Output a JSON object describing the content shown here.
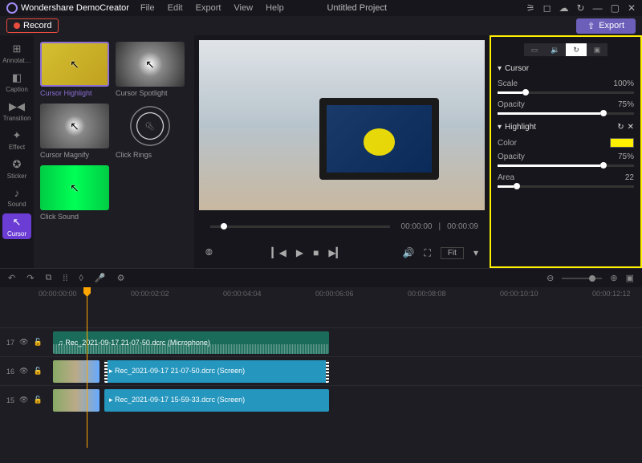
{
  "app": {
    "name": "Wondershare DemoCreator",
    "project": "Untitled Project"
  },
  "menu": [
    "File",
    "Edit",
    "Export",
    "View",
    "Help"
  ],
  "toolbar": {
    "record": "Record",
    "export": "Export"
  },
  "sidebar": [
    {
      "icon": "⊞",
      "label": "Annotat…"
    },
    {
      "icon": "◧",
      "label": "Caption"
    },
    {
      "icon": "▶◀",
      "label": "Transition"
    },
    {
      "icon": "✦",
      "label": "Effect"
    },
    {
      "icon": "✪",
      "label": "Sticker"
    },
    {
      "icon": "♪",
      "label": "Sound"
    },
    {
      "icon": "↖",
      "label": "Cursor"
    }
  ],
  "effects": [
    {
      "label": "Cursor Highlight",
      "selected": true,
      "cls": "th-yellow"
    },
    {
      "label": "Cursor Spotlight",
      "selected": false,
      "cls": "th-spot"
    },
    {
      "label": "Cursor Magnify",
      "selected": false,
      "cls": "th-mag"
    },
    {
      "label": "Click Rings",
      "selected": false,
      "cls": "th-ring"
    },
    {
      "label": "Click Sound",
      "selected": false,
      "cls": "th-sound"
    }
  ],
  "preview": {
    "time_current": "00:00:00",
    "time_total": "00:00:09",
    "fit": "Fit"
  },
  "properties": {
    "cursor": {
      "title": "Cursor",
      "scale_label": "Scale",
      "scale": "100%",
      "opacity_label": "Opacity",
      "opacity": "75%"
    },
    "highlight": {
      "title": "Highlight",
      "color_label": "Color",
      "color": "#fff000",
      "opacity_label": "Opacity",
      "opacity": "75%",
      "area_label": "Area",
      "area": "22"
    }
  },
  "timeline": {
    "ticks": [
      "00:00:00:00",
      "00:00:02:02",
      "00:00:04:04",
      "00:00:06:06",
      "00:00:08:08",
      "00:00:10:10",
      "00:00:12:12"
    ],
    "tracks": [
      {
        "num": "17",
        "clip": "Rec_2021-09-17 21-07-50.dcrc (Microphone)",
        "type": "audio"
      },
      {
        "num": "16",
        "clip": "Rec_2021-09-17 21-07-50.dcrc (Screen)",
        "type": "video1"
      },
      {
        "num": "15",
        "clip": "Rec_2021-09-17 15-59-33.dcrc (Screen)",
        "type": "video2"
      }
    ]
  }
}
